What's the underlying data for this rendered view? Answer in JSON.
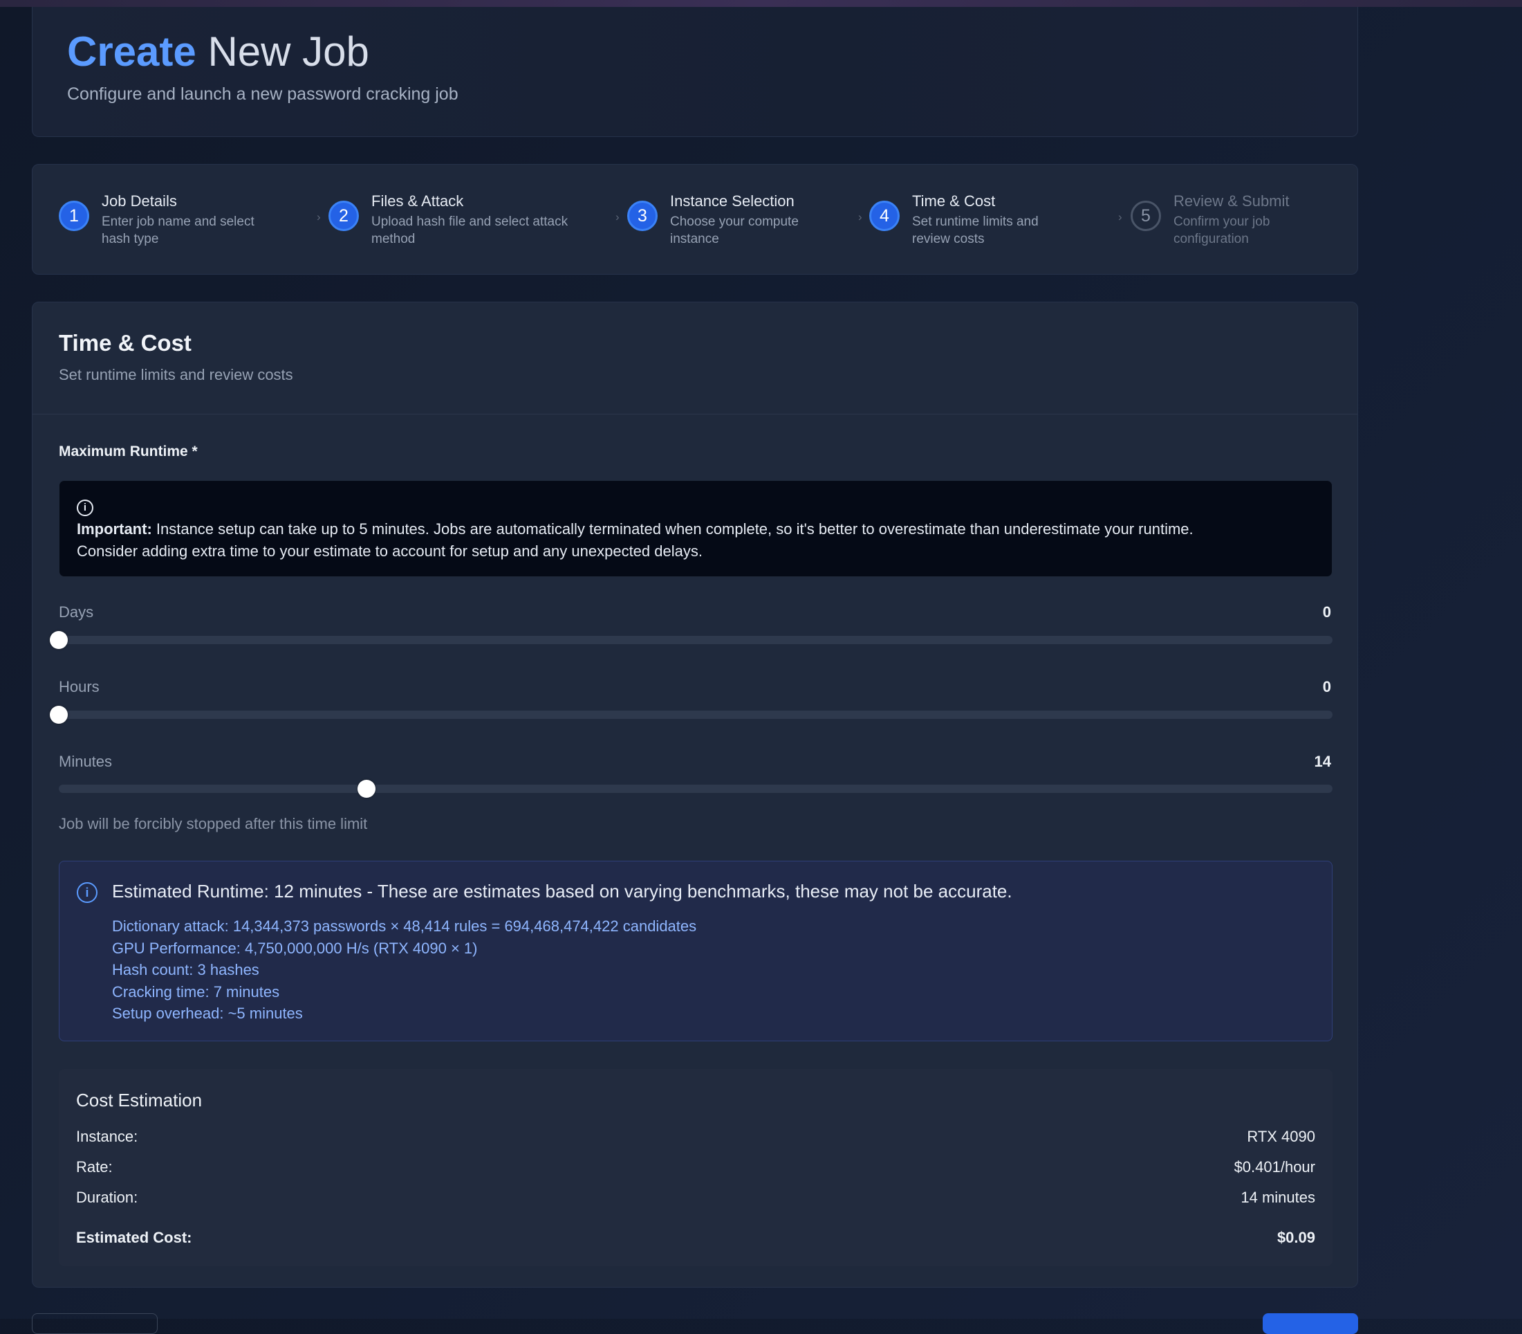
{
  "header": {
    "title_accent": "Create",
    "title_rest": "New Job",
    "subtitle": "Configure and launch a new password cracking job"
  },
  "steps": [
    {
      "number": "1",
      "title": "Job Details",
      "desc_line1": "Enter job name and select",
      "desc_line2": "hash type",
      "state": "complete"
    },
    {
      "number": "2",
      "title": "Files & Attack",
      "desc_line1": "Upload hash file and select attack",
      "desc_line2": "method",
      "state": "complete"
    },
    {
      "number": "3",
      "title": "Instance Selection",
      "desc_line1": "Choose your compute",
      "desc_line2": "instance",
      "state": "complete"
    },
    {
      "number": "4",
      "title": "Time & Cost",
      "desc_line1": "Set runtime limits and",
      "desc_line2": "review costs",
      "state": "current"
    },
    {
      "number": "5",
      "title": "Review & Submit",
      "desc_line1": "Confirm your job",
      "desc_line2": "configuration",
      "state": "upcoming"
    }
  ],
  "section": {
    "title": "Time & Cost",
    "subtitle": "Set runtime limits and review costs"
  },
  "runtime": {
    "label": "Maximum Runtime *",
    "warning_bold": "Important:",
    "warning_line1": " Instance setup can take up to 5 minutes. Jobs are automatically terminated when complete, so it's better to overestimate than underestimate your runtime.",
    "warning_line2": "Consider adding extra time to your estimate to account for setup and any unexpected delays.",
    "days": {
      "label": "Days",
      "value": "0",
      "fraction": 0.0
    },
    "hours": {
      "label": "Hours",
      "value": "0",
      "fraction": 0.0
    },
    "minutes": {
      "label": "Minutes",
      "value": "14",
      "fraction": 0.2414
    },
    "hint": "Job will be forcibly stopped after this time limit"
  },
  "estimate": {
    "title": "Estimated Runtime: 12 minutes - These are estimates based on varying benchmarks, these may not be accurate.",
    "lines": [
      "Dictionary attack: 14,344,373 passwords × 48,414 rules = 694,468,474,422 candidates",
      "GPU Performance: 4,750,000,000 H/s (RTX 4090 × 1)",
      "Hash count: 3 hashes",
      "Cracking time: 7 minutes",
      "Setup overhead: ~5 minutes"
    ]
  },
  "cost": {
    "title": "Cost Estimation",
    "instance_label": "Instance:",
    "instance_value": "RTX 4090",
    "rate_label": "Rate:",
    "rate_value": "$0.401/hour",
    "duration_label": "Duration:",
    "duration_value": "14 minutes",
    "total_label": "Estimated Cost:",
    "total_value": "$0.09"
  },
  "colors": {
    "accent": "#5b9bff",
    "step_active": "#2462e6",
    "background": "#131d31",
    "info_box": "#212a4a",
    "warning_box": "#050a16"
  },
  "icons": {
    "info": "info-circle-icon",
    "step_separator": "chevron-right-icon"
  }
}
